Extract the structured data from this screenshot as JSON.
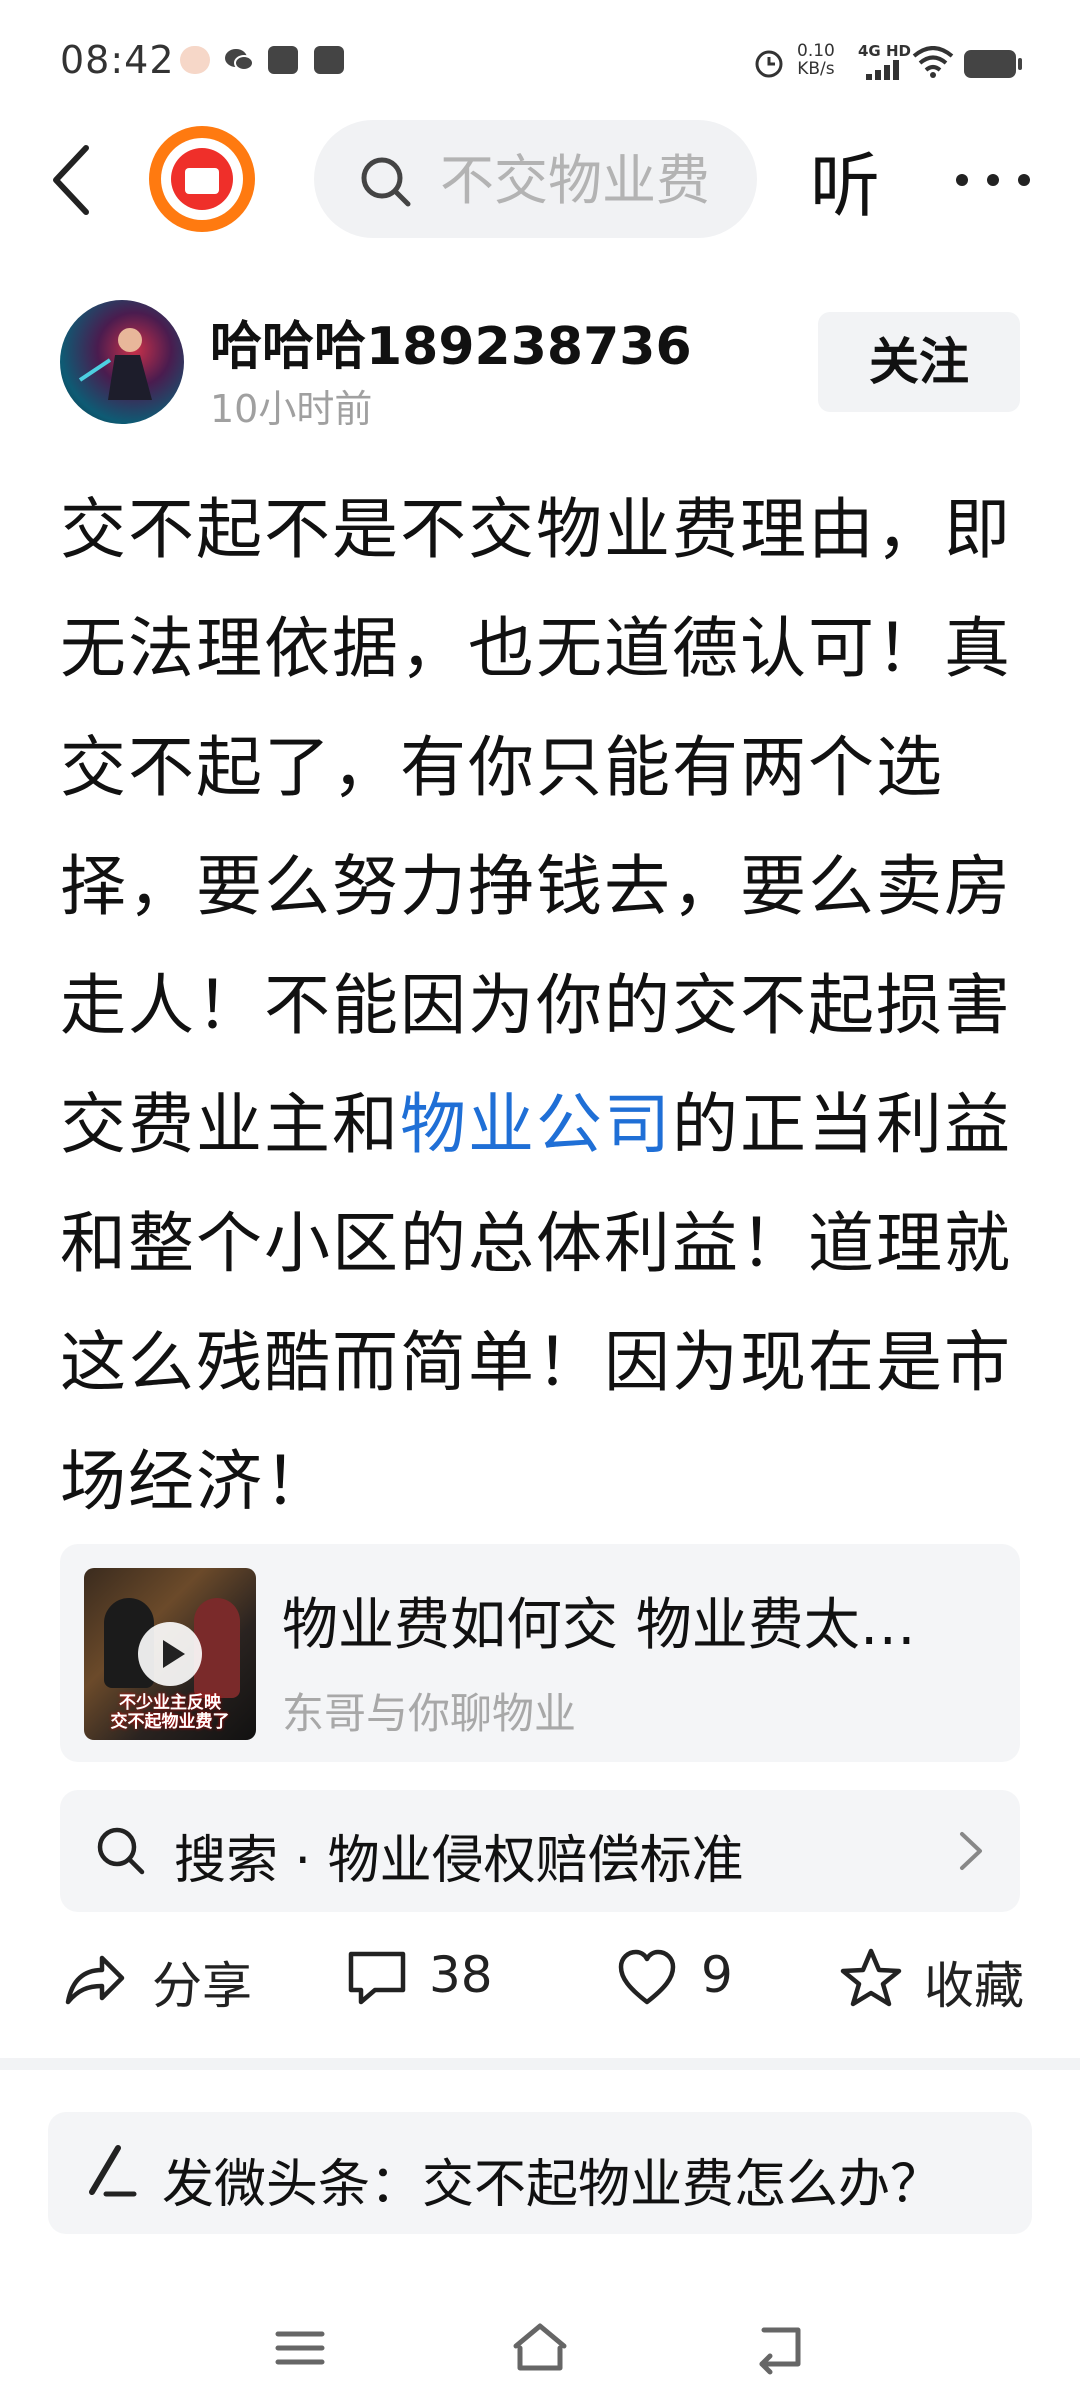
{
  "status_bar": {
    "time": "08:42",
    "network_speed_value": "0.10",
    "network_speed_unit": "KB/s",
    "signal_label": "4G HD",
    "icons": [
      "avatar-notification-icon",
      "wechat-icon",
      "toutiao-icon",
      "message-icon",
      "alarm-icon",
      "signal-icon",
      "wifi-icon",
      "battery-icon"
    ]
  },
  "header": {
    "search_placeholder": "不交物业费",
    "listen_label": "听",
    "icons": [
      "back-icon",
      "red-envelope-icon",
      "search-icon",
      "more-icon"
    ]
  },
  "author": {
    "name": "哈哈哈189238736",
    "time": "10小时前",
    "follow_label": "关注"
  },
  "post": {
    "text_before_link": "交不起不是不交物业费理由，即无法理依据，也无道德认可！真交不起了，有你只能有两个选择，要么努力挣钱去，要么卖房走人！不能因为你的交不起损害交费业主和",
    "link_text": "物业公司",
    "text_after_link": "的正当利益和整个小区的总体利益！道理就这么残酷而简单！因为现在是市场经济！",
    "link_color": "#1f6fd6"
  },
  "video_card": {
    "title": "物业费如何交 物业费太…",
    "source": "东哥与你聊物业",
    "thumb_caption_line1": "不少业主反映",
    "thumb_caption_line2": "交不起物业费了"
  },
  "search_suggestion": {
    "text": "搜索 · 物业侵权赔偿标准"
  },
  "actions": {
    "share_label": "分享",
    "comment_count": "38",
    "like_count": "9",
    "favorite_label": "收藏"
  },
  "compose_bar": {
    "text": "发微头条：交不起物业费怎么办？"
  },
  "nav_bar": {
    "icons": [
      "menu-icon",
      "home-icon",
      "back-nav-icon"
    ]
  }
}
